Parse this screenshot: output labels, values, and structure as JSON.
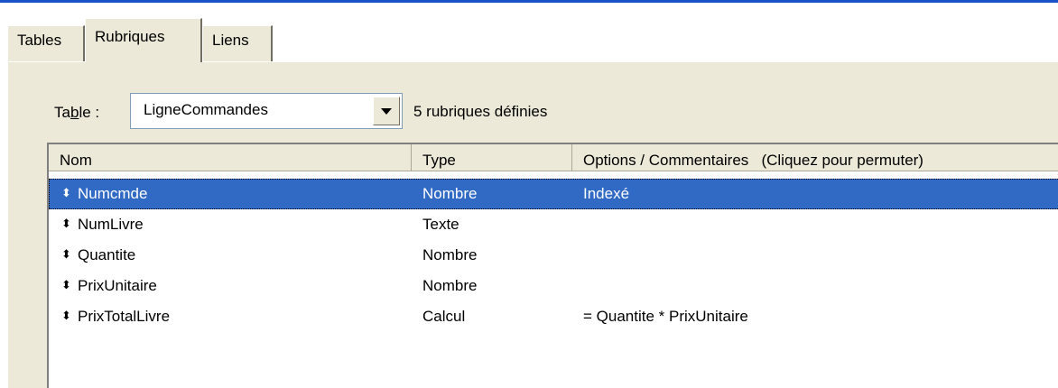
{
  "tabs": [
    {
      "label": "Tables"
    },
    {
      "label": "Rubriques"
    },
    {
      "label": "Liens"
    }
  ],
  "table_selector": {
    "label_pre": "Ta",
    "label_underlined": "b",
    "label_post": "le :",
    "selected": "LigneCommandes",
    "count_text": "5 rubriques définies"
  },
  "columns": {
    "nom": "Nom",
    "type": "Type",
    "options": "Options / Commentaires   (Cliquez pour permuter)"
  },
  "rows": [
    {
      "name": "Numcmde",
      "type": "Nombre",
      "options": "Indexé"
    },
    {
      "name": "NumLivre",
      "type": "Texte",
      "options": ""
    },
    {
      "name": "Quantite",
      "type": "Nombre",
      "options": ""
    },
    {
      "name": "PrixUnitaire",
      "type": "Nombre",
      "options": ""
    },
    {
      "name": "PrixTotalLivre",
      "type": "Calcul",
      "options": "= Quantite * PrixUnitaire"
    }
  ],
  "grip_symbol": "⬍",
  "colors": {
    "selection": "#316ac5",
    "panel": "#ece9d8",
    "title_strip": "#1a52c9"
  }
}
